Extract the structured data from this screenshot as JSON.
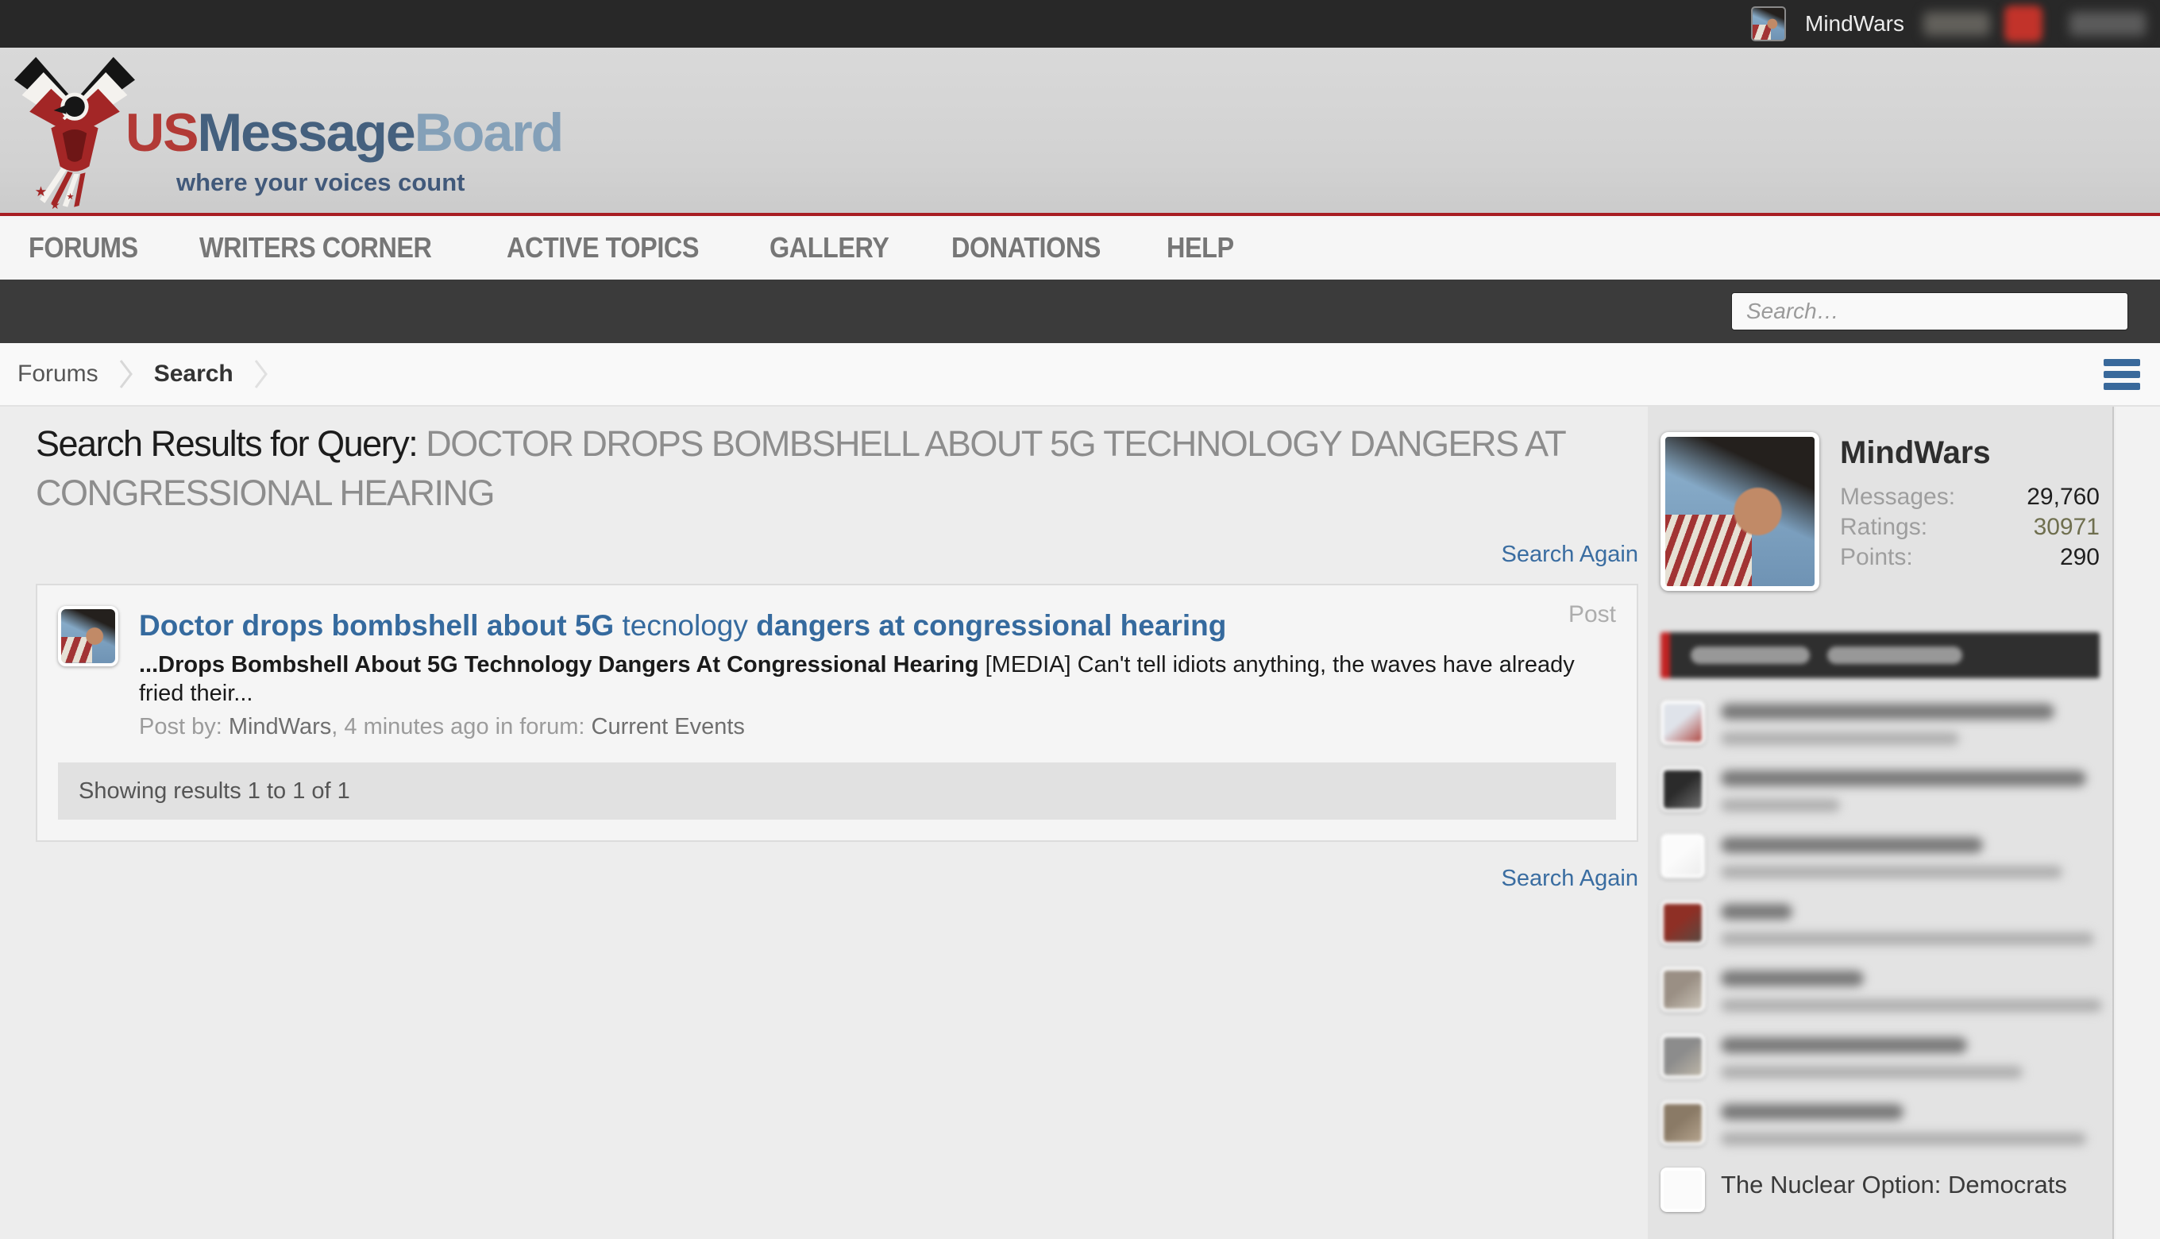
{
  "topbar": {
    "username": "MindWars"
  },
  "logo": {
    "us": "US",
    "message": "Message",
    "board": "Board",
    "tagline": "where your voices count"
  },
  "nav": {
    "items": [
      "FORUMS",
      "WRITERS CORNER",
      "ACTIVE TOPICS",
      "GALLERY",
      "DONATIONS",
      "HELP"
    ]
  },
  "search": {
    "placeholder": "Search…"
  },
  "breadcrumb": {
    "forums": "Forums",
    "search": "Search"
  },
  "page": {
    "title_prefix": "Search Results for Query: ",
    "title_query": "DOCTOR DROPS BOMBSHELL ABOUT 5G TECHNOLOGY DANGERS AT CONGRESSIONAL HEARING",
    "search_again": "Search Again",
    "showing": "Showing results 1 to 1 of 1"
  },
  "result": {
    "type_label": "Post",
    "title_bold_1": "Doctor drops bombshell about 5G",
    "title_regular": " tecnology ",
    "title_bold_2": "dangers at congressional hearing",
    "snippet_bold": "...Drops Bombshell About 5G Technology Dangers At Congressional Hearing",
    "snippet_regular": " [MEDIA] Can't tell idiots anything, the waves have already fried their...",
    "meta_prefix": "Post by: ",
    "meta_author": "MindWars",
    "meta_middle": ", 4 minutes ago in forum: ",
    "meta_forum": "Current Events"
  },
  "sidebar": {
    "profile": {
      "name": "MindWars",
      "stats": [
        {
          "label": "Messages:",
          "value": "29,760"
        },
        {
          "label": "Ratings:",
          "value": "30971"
        },
        {
          "label": "Points:",
          "value": "290"
        }
      ]
    },
    "partial_topic": "The Nuclear Option: Democrats",
    "topics_blurred": [
      {
        "c1": "#dfe3ea",
        "c2": "#b04a44",
        "tw": 420,
        "mw": 300
      },
      {
        "c1": "#2b2b2b",
        "c2": "#6e6e6e",
        "tw": 460,
        "mw": 150
      },
      {
        "c1": "#fbfbfb",
        "c2": "#ededed",
        "tw": 330,
        "mw": 430
      },
      {
        "c1": "#8e2f25",
        "c2": "#5a4a42",
        "tw": 90,
        "mw": 470
      },
      {
        "c1": "#9a8f84",
        "c2": "#c9c2b6",
        "tw": 180,
        "mw": 480
      },
      {
        "c1": "#8c8c8c",
        "c2": "#bdb6a8",
        "tw": 310,
        "mw": 380
      },
      {
        "c1": "#8a7a66",
        "c2": "#b5a48e",
        "tw": 230,
        "mw": 460
      }
    ]
  },
  "colors": {
    "accent_red": "#a81d22",
    "link_blue": "#3a6da1",
    "ratings_olive": "#6f6f4f",
    "hamburger_blue": "#39699b"
  }
}
